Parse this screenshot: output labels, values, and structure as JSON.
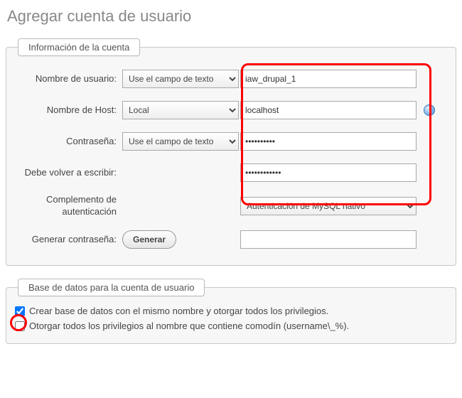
{
  "page": {
    "title": "Agregar cuenta de usuario"
  },
  "account_fieldset": {
    "legend": "Información de la cuenta",
    "username": {
      "label": "Nombre de usuario:",
      "select": "Use el campo de texto",
      "value": "iaw_drupal_1"
    },
    "host": {
      "label": "Nombre de Host:",
      "select": "Local",
      "value": "localhost"
    },
    "password": {
      "label": "Contraseña:",
      "select": "Use el campo de texto",
      "value": "••••••••••"
    },
    "retype": {
      "label": "Debe volver a escribir:",
      "value": "••••••••••••"
    },
    "auth_plugin": {
      "label": "Complemento de autenticación",
      "value": "Autenticación de MySQL nativo"
    },
    "generate": {
      "label": "Generar contraseña:",
      "button": "Generar",
      "value": ""
    }
  },
  "db_fieldset": {
    "legend": "Base de datos para la cuenta de usuario",
    "create_same": {
      "label": "Crear base de datos con el mismo nombre y otorgar todos los privilegios.",
      "checked": true
    },
    "wildcard": {
      "label": "Otorgar todos los privilegios al nombre que contiene comodín (username\\_%).",
      "checked": false
    }
  }
}
